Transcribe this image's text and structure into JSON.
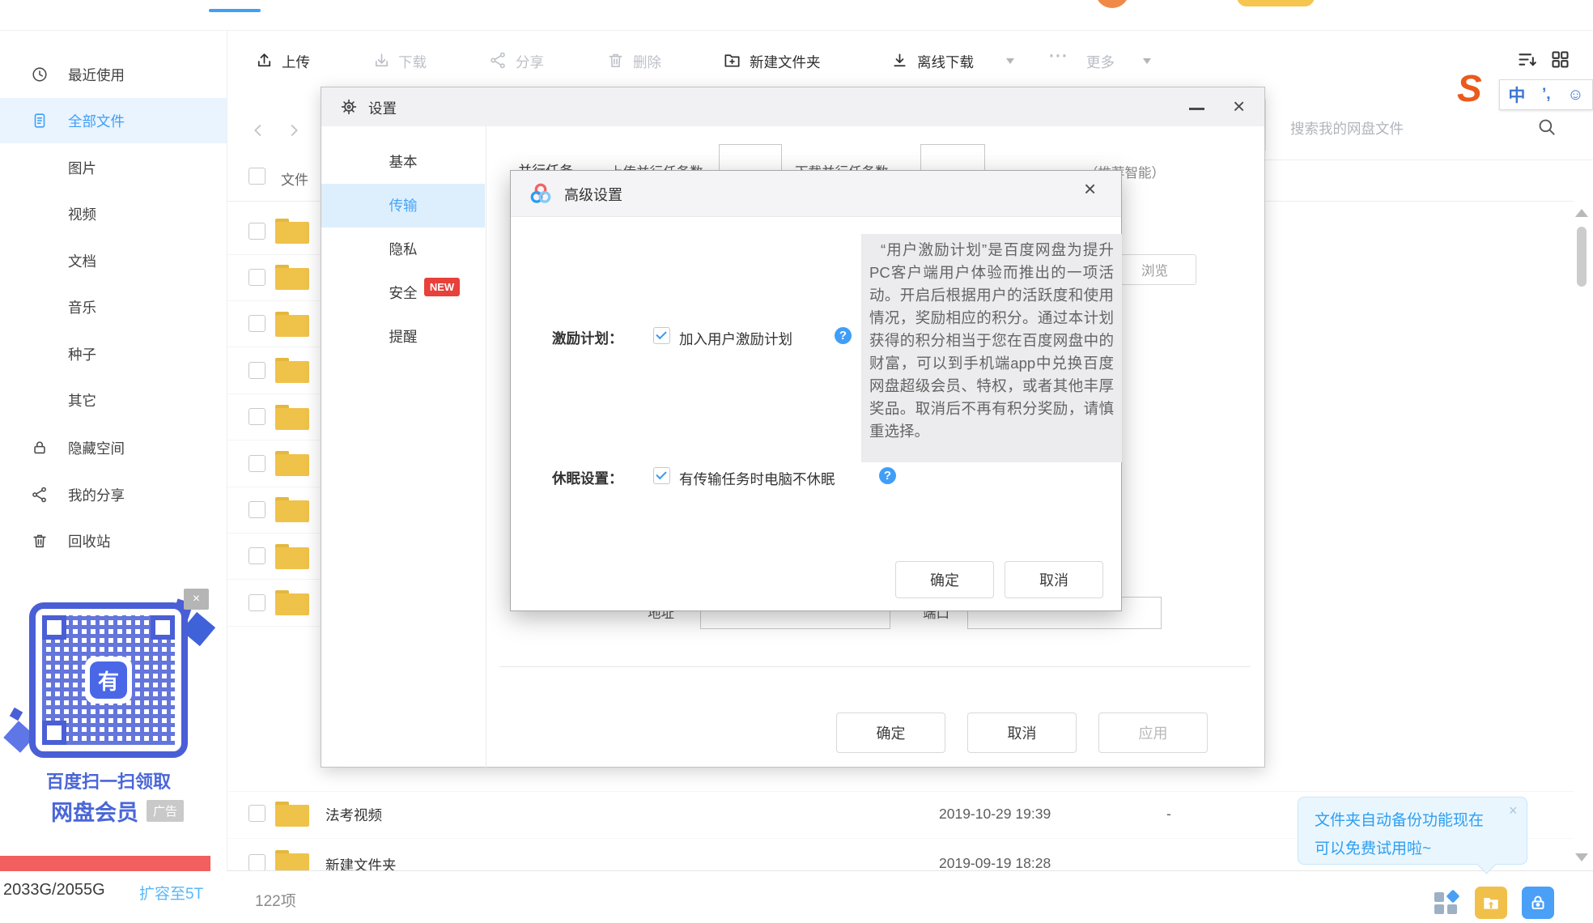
{
  "sidebar": {
    "items": [
      {
        "label": "最近使用"
      },
      {
        "label": "全部文件"
      },
      {
        "label": "图片"
      },
      {
        "label": "视频"
      },
      {
        "label": "文档"
      },
      {
        "label": "音乐"
      },
      {
        "label": "种子"
      },
      {
        "label": "其它"
      },
      {
        "label": "隐藏空间"
      },
      {
        "label": "我的分享"
      },
      {
        "label": "回收站"
      }
    ],
    "qr": {
      "close": "×",
      "logo": "有",
      "line1": "百度扫一扫领取",
      "line2": "网盘会员",
      "ad": "广告"
    },
    "storage": {
      "usage": "2033G/2055G",
      "upgrade": "扩容至5T"
    }
  },
  "toolbar": {
    "upload": "上传",
    "download": "下载",
    "share": "分享",
    "delete": "删除",
    "new_folder": "新建文件夹",
    "offline": "离线下载",
    "more_dots": "···",
    "more": "更多"
  },
  "search": {
    "placeholder": "搜索我的网盘文件"
  },
  "list": {
    "file_col": "文件",
    "sliver_rows": 9,
    "rows": [
      {
        "name": "法考视频",
        "date": "2019-10-29 19:39",
        "size": "-"
      },
      {
        "name": "新建文件夹",
        "date": "2019-09-19 18:28",
        "size": ""
      }
    ]
  },
  "status": {
    "count": "122项"
  },
  "settings": {
    "title": "设置",
    "minimize": "—",
    "close": "×",
    "tabs": [
      "基本",
      "传输",
      "隐私",
      "安全",
      "提醒"
    ],
    "new_badge": "NEW",
    "ok": "确定",
    "cancel": "取消",
    "apply": "应用",
    "bg_fields": {
      "section": "并行任务",
      "upload_label": "上传并行任务数",
      "download_label": "下载并行任务数",
      "hint": "（推荐智能）",
      "addr": "地址",
      "port": "端口",
      "browse": "浏览"
    }
  },
  "modal": {
    "title": "高级设置",
    "close": "×",
    "incentive_label": "激励计划：",
    "incentive_text": "加入用户激励计划",
    "help": "?",
    "tooltip": "“用户激励计划”是百度网盘为提升PC客户端用户体验而推出的一项活动。开启后根据用户的活跃度和使用情况，奖励相应的积分。通过本计划获得的积分相当于您在百度网盘中的财富，可以到手机端app中兑换百度网盘超级会员、特权，或者其他丰厚奖品。取消后不再有积分奖励，请慎重选择。",
    "sleep_label": "休眠设置：",
    "sleep_text": "有传输任务时电脑不休眠",
    "ok": "确定",
    "cancel": "取消"
  },
  "backup_tip": {
    "line1": "文件夹自动备份功能现在",
    "line2": "可以免费试用啦~",
    "close": "×"
  },
  "ime": {
    "s": "S",
    "zh": "中",
    "punct": "’,",
    "smiley": "☺"
  }
}
